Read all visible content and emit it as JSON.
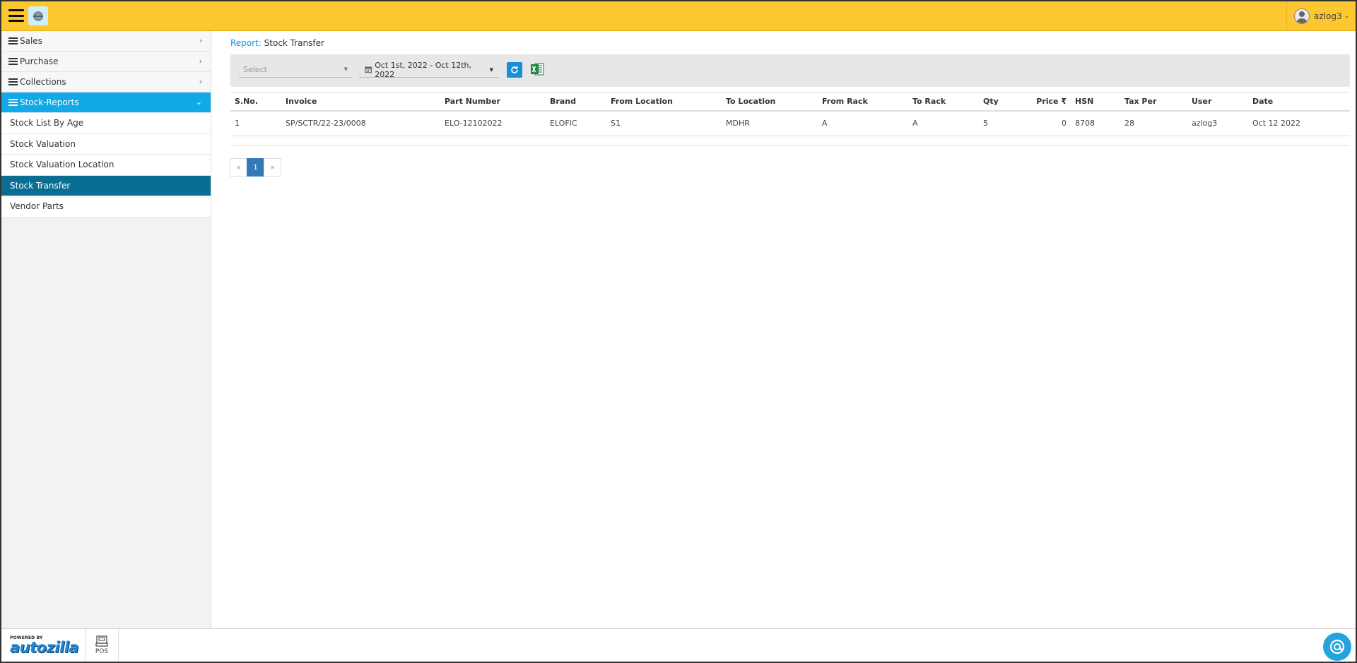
{
  "header": {
    "user_name": "azlog3"
  },
  "sidebar": {
    "menus": [
      {
        "label": "Sales"
      },
      {
        "label": "Purchase"
      },
      {
        "label": "Collections"
      },
      {
        "label": "Stock-Reports"
      }
    ],
    "sub_items": [
      {
        "label": "Stock List By Age"
      },
      {
        "label": "Stock Valuation"
      },
      {
        "label": "Stock Valuation Location"
      },
      {
        "label": "Stock Transfer"
      },
      {
        "label": "Vendor Parts"
      }
    ]
  },
  "breadcrumb": {
    "root": "Report",
    "separator": ":",
    "current": "Stock Transfer"
  },
  "filters": {
    "select_placeholder": "Select",
    "date_range": "Oct 1st, 2022 - Oct 12th, 2022"
  },
  "table": {
    "columns": [
      "S.No.",
      "Invoice",
      "Part Number",
      "Brand",
      "From Location",
      "To Location",
      "From Rack",
      "To Rack",
      "Qty",
      "Price ₹",
      "HSN",
      "Tax Per",
      "User",
      "Date"
    ],
    "rows": [
      [
        "1",
        "SP/SCTR/22-23/0008",
        "ELO-12102022",
        "ELOFIC",
        "S1",
        "MDHR",
        "A",
        "A",
        "5",
        "0",
        "8708",
        "28",
        "azlog3",
        "Oct 12 2022"
      ]
    ]
  },
  "pagination": {
    "prev": "«",
    "current": "1",
    "next": "»"
  },
  "footer": {
    "powered_by": "POWERED BY",
    "brand": "autozilla",
    "pos_label": "POS"
  }
}
